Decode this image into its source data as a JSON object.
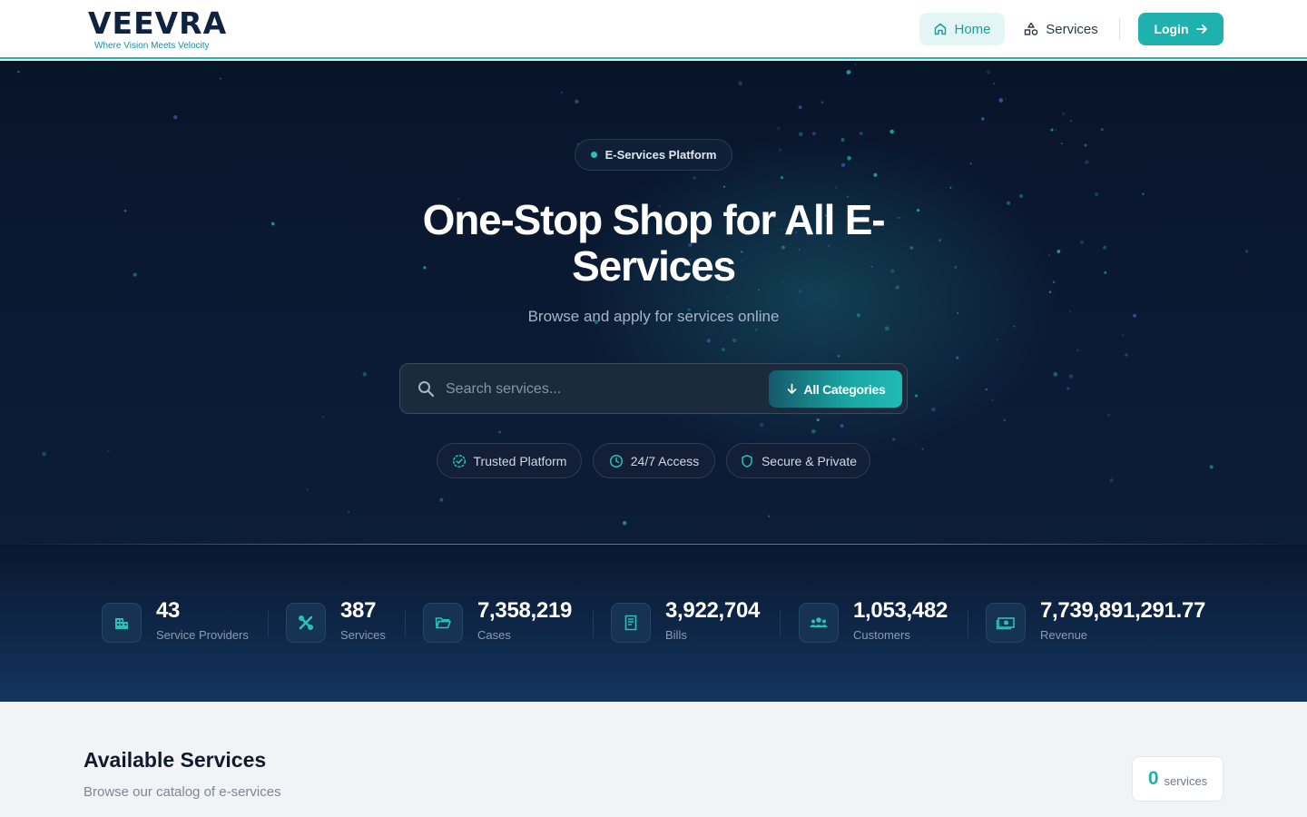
{
  "brand": {
    "name": "VEEVRA",
    "tagline": "Where Vision Meets Velocity"
  },
  "nav": {
    "home_label": "Home",
    "services_label": "Services",
    "login_label": "Login"
  },
  "hero": {
    "badge": "E-Services Platform",
    "title": "One-Stop Shop for All E-Services",
    "subtitle": "Browse and apply for services online",
    "search_placeholder": "Search services...",
    "category_button": "All Categories",
    "features": [
      "Trusted Platform",
      "24/7 Access",
      "Secure & Private"
    ]
  },
  "stats": [
    {
      "value": "43",
      "label": "Service Providers",
      "icon": "building-icon"
    },
    {
      "value": "387",
      "label": "Services",
      "icon": "tools-icon"
    },
    {
      "value": "7,358,219",
      "label": "Cases",
      "icon": "folder-icon"
    },
    {
      "value": "3,922,704",
      "label": "Bills",
      "icon": "receipt-icon"
    },
    {
      "value": "1,053,482",
      "label": "Customers",
      "icon": "users-icon"
    },
    {
      "value": "7,739,891,291.77",
      "label": "Revenue",
      "icon": "money-icon"
    }
  ],
  "available": {
    "title": "Available Services",
    "subtitle": "Browse our catalog of e-services",
    "count": "0",
    "count_label": "services"
  },
  "colors": {
    "accent": "#1fb1ad",
    "navy": "#0b1a35",
    "text_dark": "#0f1b2d"
  }
}
